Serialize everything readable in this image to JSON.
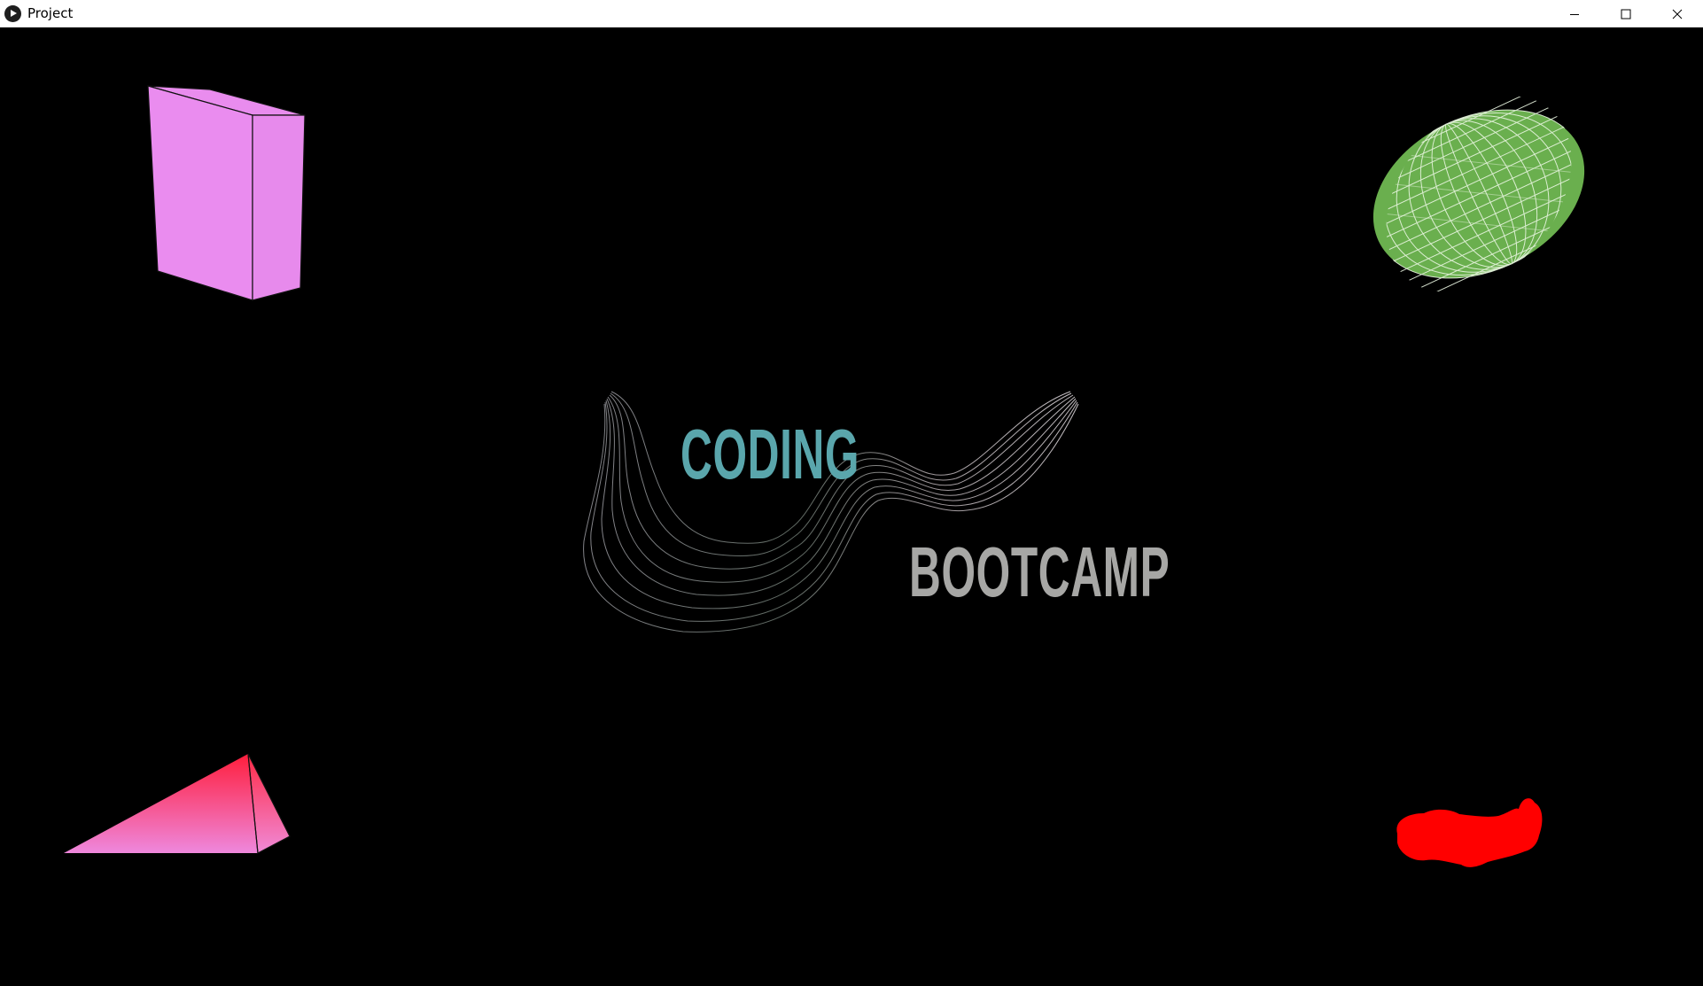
{
  "window": {
    "title": "Project",
    "controls": {
      "minimize": "minimize-icon",
      "maximize": "maximize-icon",
      "close": "close-icon"
    }
  },
  "canvas": {
    "background": "#000000",
    "logo": {
      "line1": "CODING",
      "line2": "BOOTCAMP",
      "line1_color": "#5aa6ac",
      "line2_color": "#a7a7a5"
    },
    "shapes": [
      {
        "name": "box",
        "color": "#ea8cef"
      },
      {
        "name": "wireframe-ellipsoid",
        "color": "#6aaf4e"
      },
      {
        "name": "pyramid",
        "color": "#ff2d4a"
      },
      {
        "name": "red-blob",
        "color": "#ff0000"
      }
    ]
  }
}
